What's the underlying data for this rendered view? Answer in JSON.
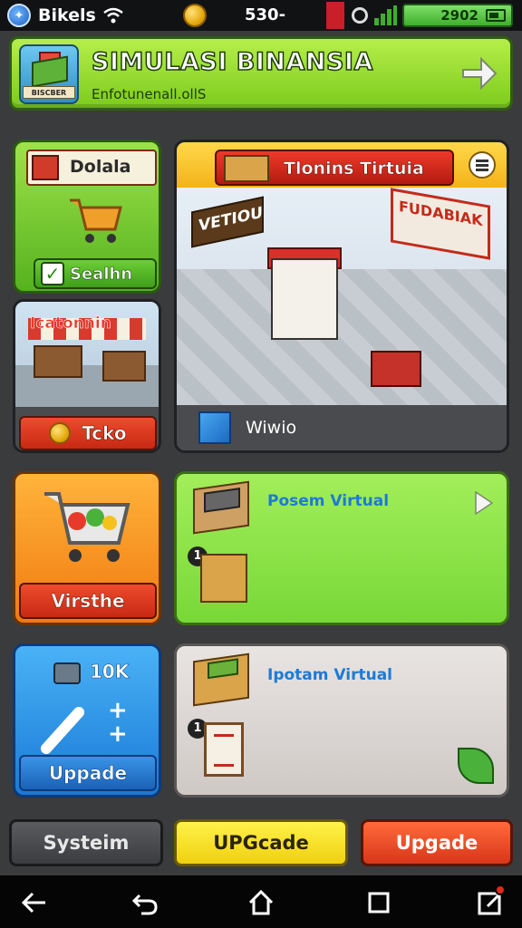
{
  "statusbar": {
    "app_name": "Bikels",
    "money": "530-",
    "battery_text": "2902"
  },
  "header": {
    "logo_label": "BISCBER",
    "title": "SIMULASI BINANSIA",
    "subtitle": "Enfotunenall.ollS"
  },
  "cards": {
    "store_small": {
      "title": "Dolala",
      "button_label": "Sealhn"
    },
    "shop": {
      "sign": "Icatonnin",
      "button_label": "Tcko"
    },
    "store_main": {
      "banner_title": "Tlonins Tirtuia",
      "sign_left": "VETIOU",
      "sign_right": "FUDABIAK",
      "bottom_label": "Wiwio"
    },
    "cart": {
      "button_label": "Virsthe"
    },
    "pos": {
      "title": "Posem Virtual",
      "badge": "1"
    },
    "update": {
      "label": "10K",
      "button_label": "Uppade"
    },
    "inventory": {
      "title": "Ipotam Virtual",
      "badge": "1"
    }
  },
  "actions": {
    "system_label": "Systeim",
    "upgrade_yellow_label": "UPGcade",
    "upgrade_red_label": "Upgade"
  },
  "colors": {
    "accent_green": "#7ccb1c",
    "accent_orange": "#f07a10",
    "accent_blue": "#1a7ad6",
    "accent_red": "#d8361a",
    "accent_yellow": "#f0d010"
  }
}
